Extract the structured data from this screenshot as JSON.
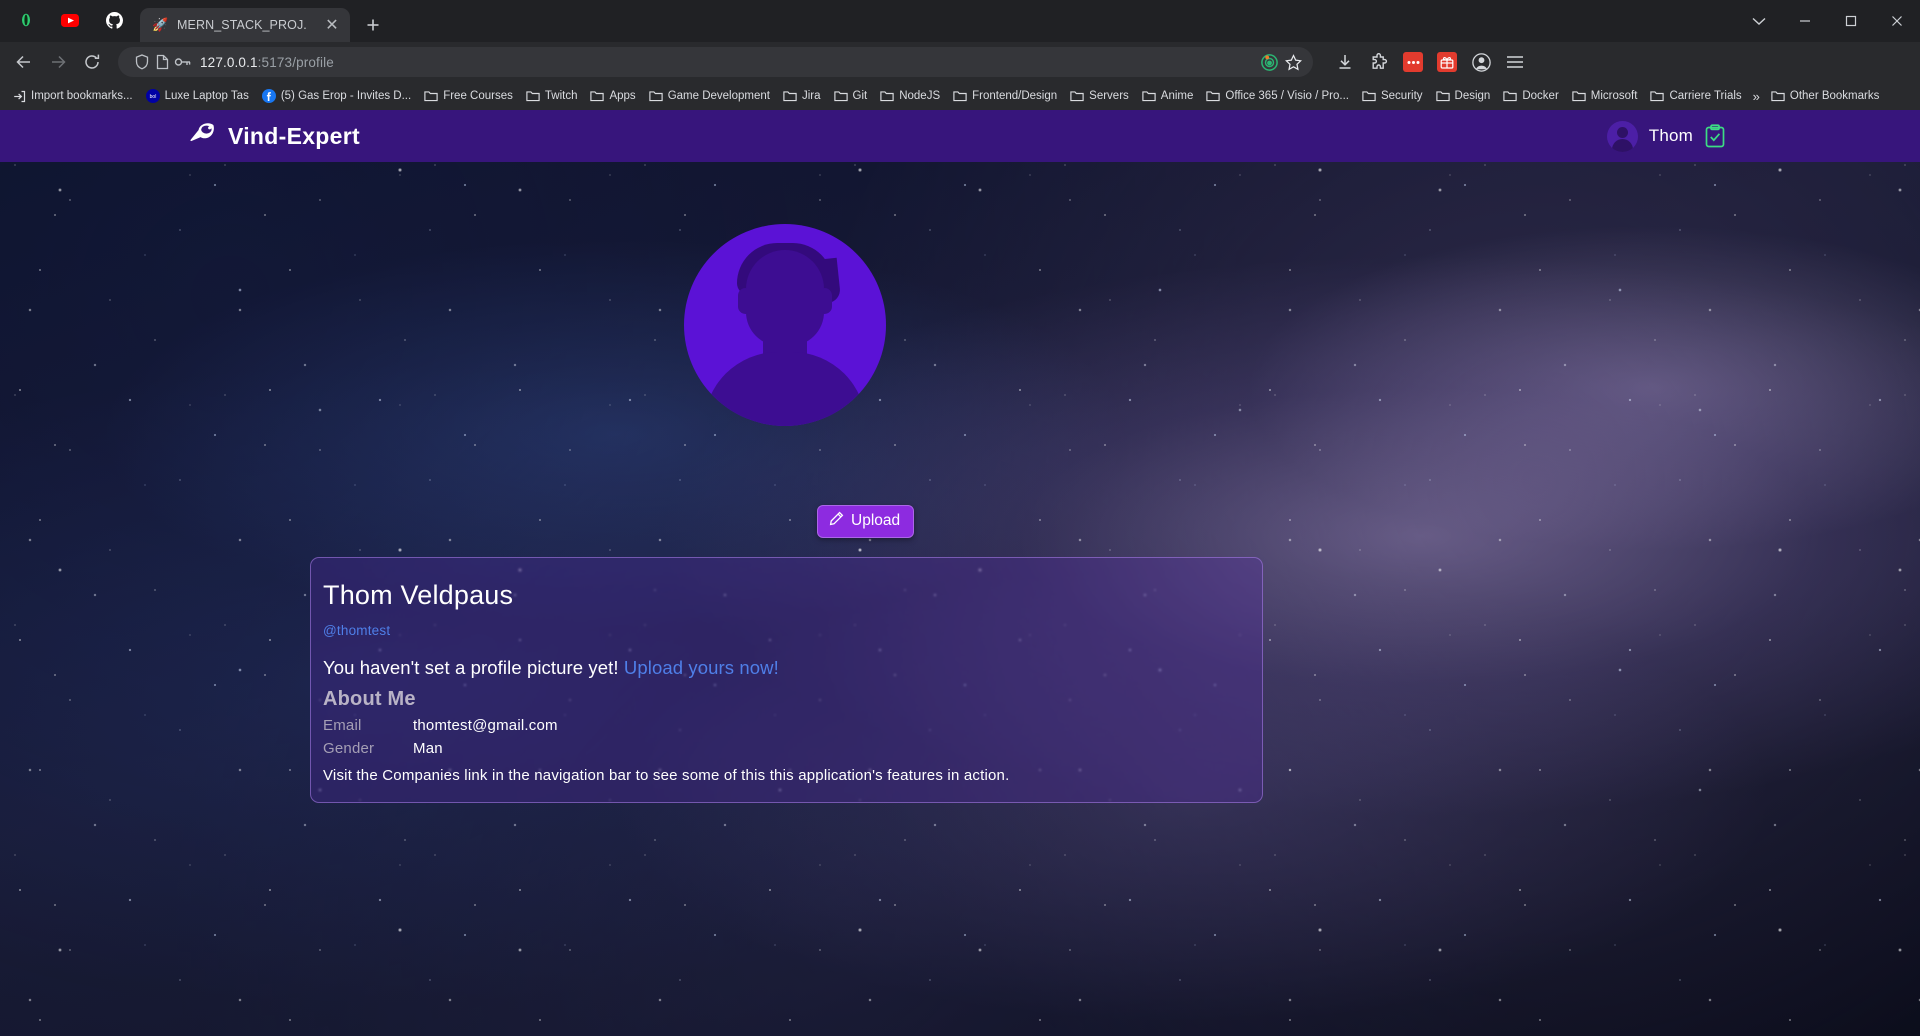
{
  "browser": {
    "pinned_tabs": [
      {
        "name": "shell-pinned-tab",
        "icon": "shell-icon"
      },
      {
        "name": "youtube-pinned-tab",
        "icon": "youtube-icon"
      },
      {
        "name": "github-pinned-tab",
        "icon": "github-icon"
      }
    ],
    "tab": {
      "title": "MERN_STACK_PROJ.",
      "favicon": "rocket-icon",
      "close_label": "✕"
    },
    "new_tab_label": "+",
    "window_controls": {
      "minimize": "─",
      "maximize": "□",
      "close": "✕",
      "chevron": "⌄"
    },
    "omnibox": {
      "host": "127.0.0.1",
      "path": ":5173/profile",
      "shield_icon": "shield-icon",
      "page_icon": "page-icon",
      "key_icon": "key-icon",
      "target_icon": "target-extension-icon",
      "bookmark_icon": "star-icon"
    },
    "toolbar_right": [
      {
        "name": "downloads-button",
        "icon": "download-icon"
      },
      {
        "name": "extensions-button",
        "icon": "puzzle-icon"
      },
      {
        "name": "extension-red-dots-button",
        "icon": "red-extension-icon"
      },
      {
        "name": "extension-red-gift-button",
        "icon": "red-gift-extension-icon"
      },
      {
        "name": "profile-button",
        "icon": "account-icon"
      },
      {
        "name": "chrome-menu-button",
        "icon": "hamburger-icon"
      }
    ],
    "bookmarks": [
      {
        "label": "Import bookmarks...",
        "icon": "import-icon"
      },
      {
        "label": "Luxe Laptop Tas",
        "icon": "bol-icon"
      },
      {
        "label": "(5) Gas Erop - Invites D...",
        "icon": "facebook-icon"
      },
      {
        "label": "Free Courses",
        "icon": "folder-icon"
      },
      {
        "label": "Twitch",
        "icon": "folder-icon"
      },
      {
        "label": "Apps",
        "icon": "folder-icon"
      },
      {
        "label": "Game Development",
        "icon": "folder-icon"
      },
      {
        "label": "Jira",
        "icon": "folder-icon"
      },
      {
        "label": "Git",
        "icon": "folder-icon"
      },
      {
        "label": "NodeJS",
        "icon": "folder-icon"
      },
      {
        "label": "Frontend/Design",
        "icon": "folder-icon"
      },
      {
        "label": "Servers",
        "icon": "folder-icon"
      },
      {
        "label": "Anime",
        "icon": "folder-icon"
      },
      {
        "label": "Office 365 / Visio / Pro...",
        "icon": "folder-icon"
      },
      {
        "label": "Security",
        "icon": "folder-icon"
      },
      {
        "label": "Design",
        "icon": "folder-icon"
      },
      {
        "label": "Docker",
        "icon": "folder-icon"
      },
      {
        "label": "Microsoft",
        "icon": "folder-icon"
      },
      {
        "label": "Carriere Trials",
        "icon": "folder-icon"
      }
    ],
    "bookmarks_overflow_label": "»",
    "other_bookmarks": {
      "label": "Other Bookmarks",
      "icon": "folder-icon"
    }
  },
  "app": {
    "brand": {
      "name": "Vind-Expert",
      "logo_icon": "stingray-logo-icon"
    },
    "nav_user": {
      "username": "Thom",
      "avatar_icon": "user-avatar-icon",
      "clipboard_icon": "clipboard-check-icon",
      "clipboard_color": "#3ddc84"
    },
    "accent_color": "#37157c",
    "button_color": "#8d2be0"
  },
  "profile": {
    "avatar_placeholder_icon": "default-user-avatar-icon",
    "upload_button": {
      "label": "Upload",
      "icon": "pencil-icon"
    },
    "name": "Thom Veldpaus",
    "handle": "@thomtest",
    "notice_text": "You haven't set a profile picture yet!",
    "notice_link": "Upload yours now!",
    "about_title": "About Me",
    "details": [
      {
        "key": "Email",
        "value": "thomtest@gmail.com"
      },
      {
        "key": "Gender",
        "value": "Man"
      }
    ],
    "footer_text": "Visit the Companies link in the navigation bar to see some of this this application's features in action."
  }
}
